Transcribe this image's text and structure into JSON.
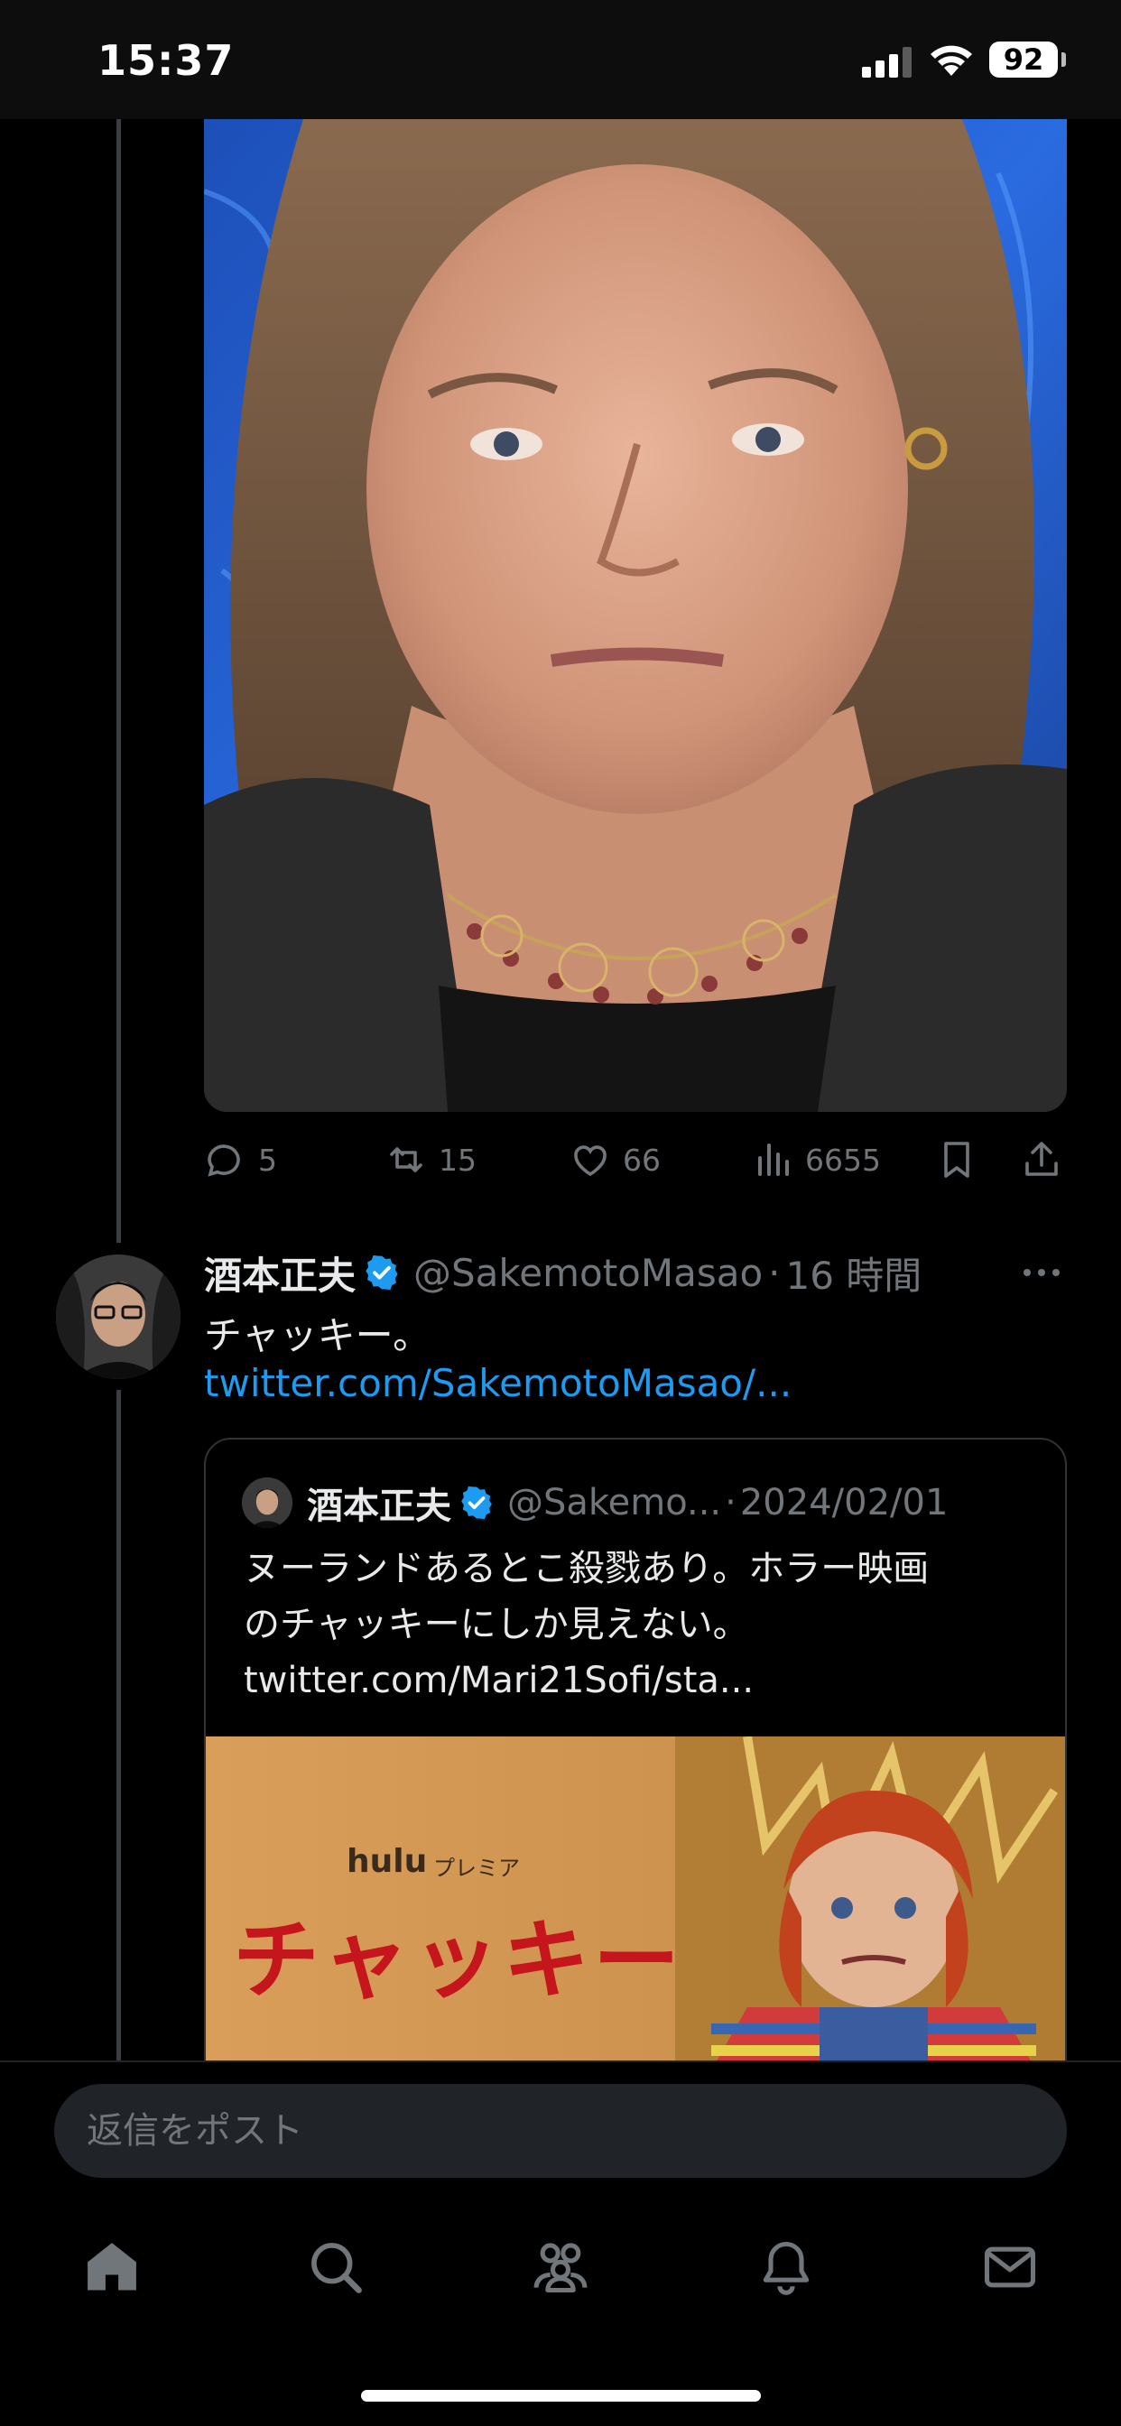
{
  "status_bar": {
    "time": "15:37",
    "battery": "92",
    "icons": [
      "signal-icon",
      "wifi-icon",
      "battery-icon"
    ]
  },
  "tweet_top": {
    "media": {
      "kind": "photo"
    },
    "actions": {
      "replies": "5",
      "reposts": "15",
      "likes": "66",
      "views": "6655"
    }
  },
  "tweet": {
    "author_name": "酒本正夫",
    "handle": "@SakemotoMasao",
    "separator": "·",
    "time": "16 時間",
    "text": "チャッキー。",
    "link": "twitter.com/SakemotoMasao/...",
    "quote": {
      "author_name": "酒本正夫",
      "handle": "@Sakemo...",
      "separator": "·",
      "date": "2024/02/01",
      "text_lines": [
        "ヌーランドあるとこ殺戮あり。ホラー映画",
        "のチャッキーにしか見えない。",
        "twitter.com/Mari21Sofi/sta..."
      ],
      "media": {
        "brand": "hulu",
        "brand_sub": "プレミア",
        "title": "チャッキー"
      }
    }
  },
  "reply": {
    "placeholder": "返信をポスト"
  },
  "bottom_nav": [
    "home-icon",
    "search-icon",
    "communities-icon",
    "notifications-icon",
    "messages-icon"
  ],
  "colors": {
    "background": "#000000",
    "text_primary": "#e7e9ea",
    "text_secondary": "#71767b",
    "link": "#1d9bf0",
    "verified": "#1d9bf0",
    "input_bg": "#202327"
  }
}
